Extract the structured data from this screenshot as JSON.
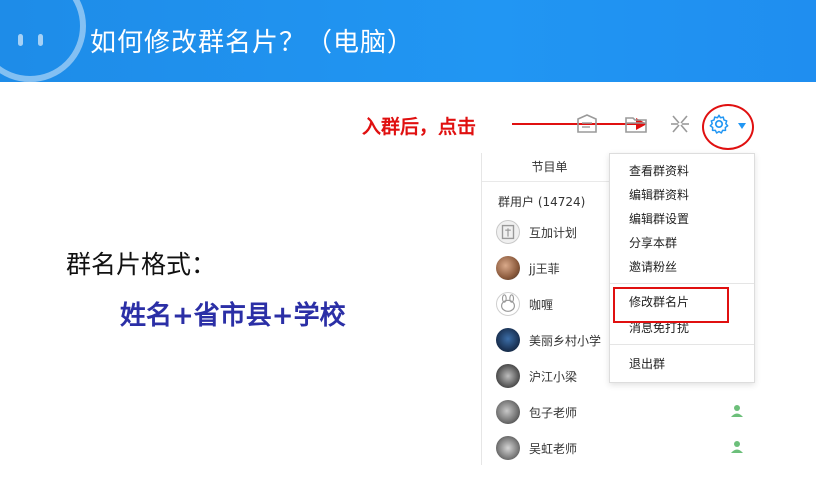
{
  "header": {
    "title": "如何修改群名片？（电脑）"
  },
  "content": {
    "format_label": "群名片格式：",
    "format_value": "姓名+省市县+学校",
    "annotation": "入群后，点击"
  },
  "panel": {
    "tab_label": "节目单",
    "members_header": "群用户 (14724)",
    "members": [
      {
        "name": "互加计划",
        "avatar": "qq-logo",
        "role": "admin"
      },
      {
        "name": "jj王菲",
        "avatar": "photo",
        "role": "member"
      },
      {
        "name": "咖喱",
        "avatar": "cartoon",
        "role": "member"
      },
      {
        "name": "美丽乡村小学",
        "avatar": "photo",
        "role": "member"
      },
      {
        "name": "沪江小梁",
        "avatar": "photo",
        "role": "member"
      },
      {
        "name": "包子老师",
        "avatar": "photo",
        "role": "member"
      },
      {
        "name": "吴虹老师",
        "avatar": "photo",
        "role": "member"
      }
    ]
  },
  "menu": {
    "items": [
      {
        "label": "查看群资料"
      },
      {
        "label": "编辑群资料"
      },
      {
        "label": "编辑群设置"
      },
      {
        "label": "分享本群"
      },
      {
        "label": "邀请粉丝"
      },
      {
        "label": "修改群名片",
        "highlighted": true
      },
      {
        "label": "消息免打扰"
      },
      {
        "label": "退出群"
      }
    ]
  },
  "colors": {
    "header_bg": "#2196f3",
    "annotation": "#e01010",
    "format_value": "#2b2fa6",
    "member_icon": "#6cbf7a",
    "gear": "#2196f3"
  },
  "icons": [
    "announcement-icon",
    "folder-icon",
    "apps-icon",
    "gear-icon",
    "dropdown-arrow-icon"
  ]
}
